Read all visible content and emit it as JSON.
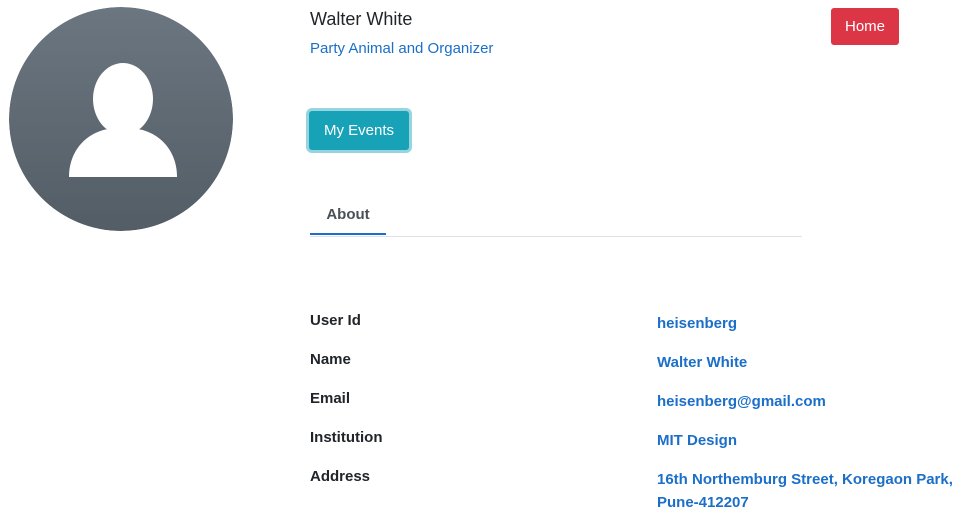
{
  "profile": {
    "name": "Walter White",
    "tagline": "Party Animal and Organizer"
  },
  "nav": {
    "home_label": "Home"
  },
  "actions": {
    "my_events_label": "My Events"
  },
  "tabs": [
    {
      "label": "About",
      "active": true
    }
  ],
  "about": [
    {
      "label": "User Id",
      "value": "heisenberg"
    },
    {
      "label": "Name",
      "value": "Walter White"
    },
    {
      "label": "Email",
      "value": "heisenberg@gmail.com"
    },
    {
      "label": "Institution",
      "value": "MIT Design"
    },
    {
      "label": "Address",
      "value": "16th Northemburg Street, Koregaon Park, Pune-412207"
    }
  ],
  "icons": {
    "avatar": "user-avatar-placeholder-icon"
  },
  "colors": {
    "accent_link": "#1b6fc9",
    "home_button": "#dc3545",
    "events_button": "#17a2b8",
    "avatar_bg": "#5f6a73"
  }
}
